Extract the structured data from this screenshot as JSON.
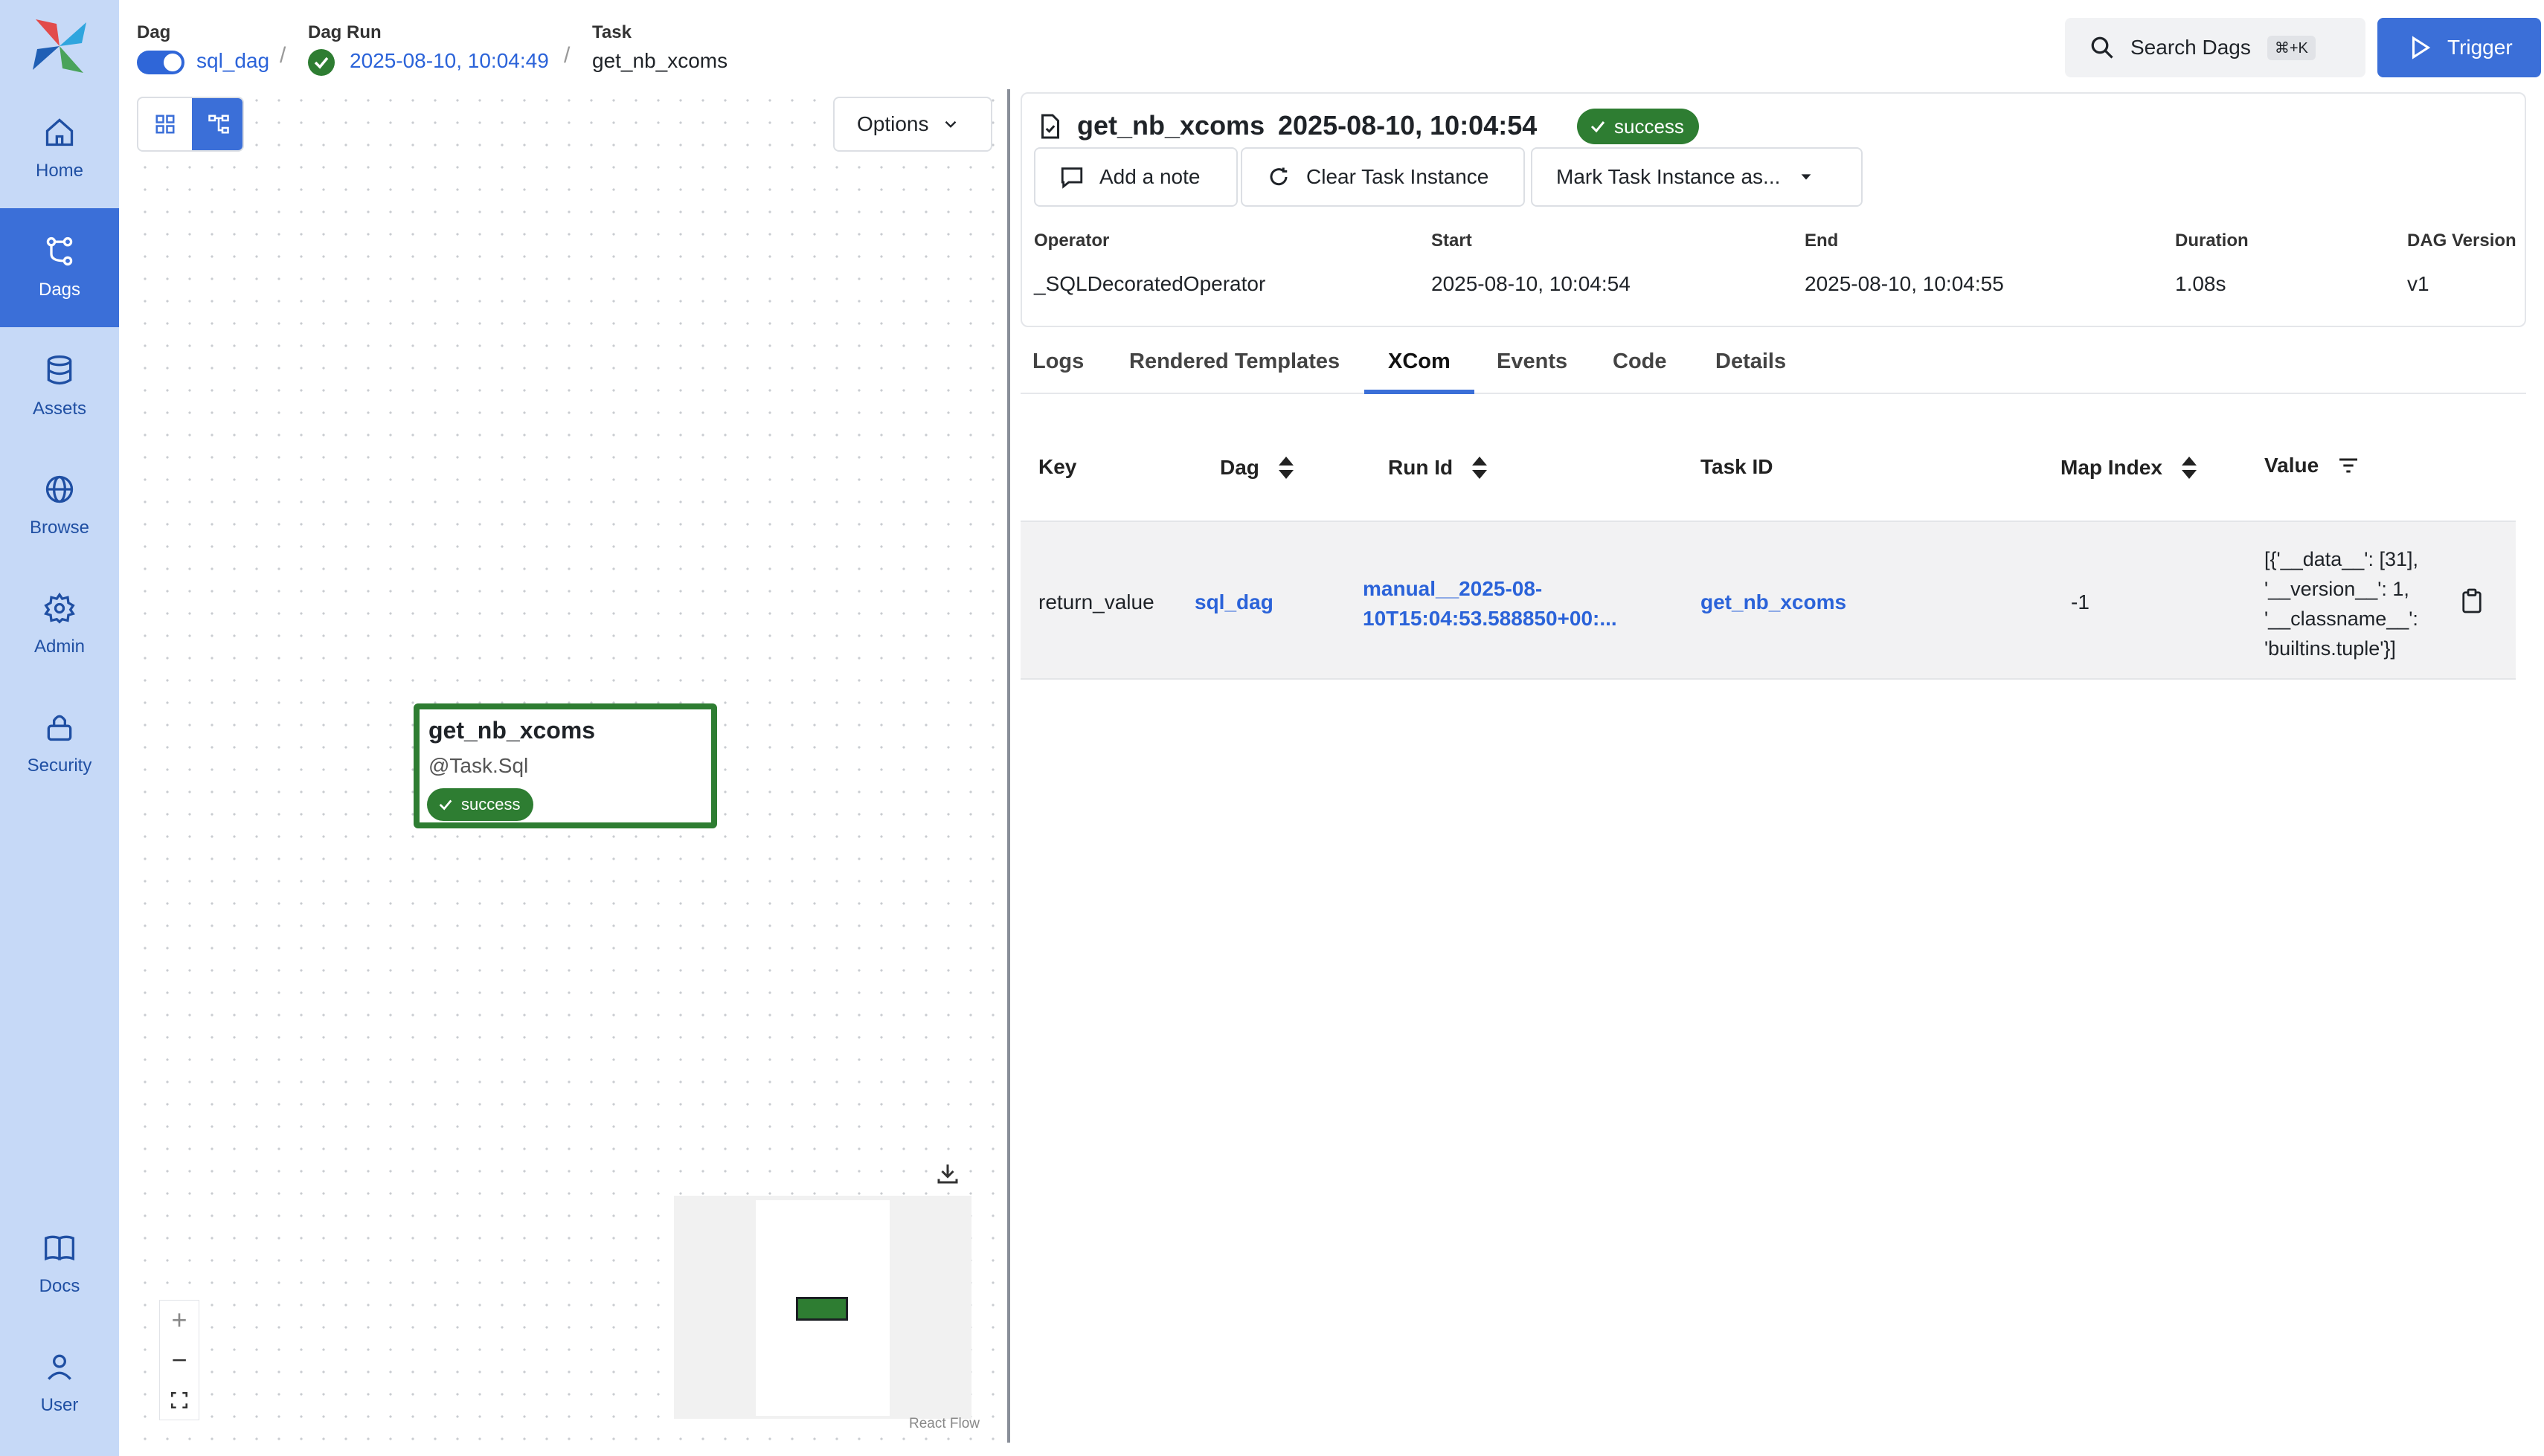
{
  "sidebar": {
    "items": [
      {
        "label": "Home",
        "icon": "home-icon"
      },
      {
        "label": "Dags",
        "icon": "dags-icon",
        "active": true
      },
      {
        "label": "Assets",
        "icon": "database-icon"
      },
      {
        "label": "Browse",
        "icon": "globe-icon"
      },
      {
        "label": "Admin",
        "icon": "gear-icon"
      },
      {
        "label": "Security",
        "icon": "lock-icon"
      },
      {
        "label": "Docs",
        "icon": "book-icon"
      },
      {
        "label": "User",
        "icon": "user-icon"
      }
    ]
  },
  "breadcrumb": {
    "dag_key": "Dag",
    "dag_value": "sql_dag",
    "run_key": "Dag Run",
    "run_value": "2025-08-10, 10:04:49",
    "task_key": "Task",
    "task_value": "get_nb_xcoms"
  },
  "header": {
    "search_label": "Search Dags",
    "search_shortcut": "⌘+K",
    "trigger_label": "Trigger"
  },
  "graph": {
    "options_label": "Options",
    "node": {
      "name": "get_nb_xcoms",
      "operator": "@Task.Sql",
      "state": "success"
    },
    "attribution": "React Flow",
    "zoom": {
      "in": "+",
      "out": "−"
    }
  },
  "task_instance": {
    "name": "get_nb_xcoms",
    "date": "2025-08-10, 10:04:54",
    "state": "success",
    "actions": {
      "add_note": "Add a note",
      "clear": "Clear Task Instance",
      "mark": "Mark Task Instance as..."
    },
    "meta": {
      "operator_key": "Operator",
      "operator_value": "_SQLDecoratedOperator",
      "start_key": "Start",
      "start_value": "2025-08-10, 10:04:54",
      "end_key": "End",
      "end_value": "2025-08-10, 10:04:55",
      "duration_key": "Duration",
      "duration_value": "1.08s",
      "version_key": "DAG Version",
      "version_value": "v1"
    }
  },
  "tabs": [
    "Logs",
    "Rendered Templates",
    "XCom",
    "Events",
    "Code",
    "Details"
  ],
  "active_tab": "XCom",
  "xcom_table": {
    "columns": [
      "Key",
      "Dag",
      "Run Id",
      "Task ID",
      "Map Index",
      "Value"
    ],
    "row": {
      "key": "return_value",
      "dag": "sql_dag",
      "run_id_line1": "manual__2025-08-",
      "run_id_line2": "10T15:04:53.588850+00:...",
      "task_id": "get_nb_xcoms",
      "map_index": "-1",
      "value_lines": [
        "[{'__data__': [31],",
        "'__version__': 1,",
        "'__classname__':",
        "'builtins.tuple'}]"
      ]
    }
  },
  "colors": {
    "brand": "#3b6fd8",
    "success": "#2e7d32",
    "sidebar": "#c6d9f7"
  }
}
